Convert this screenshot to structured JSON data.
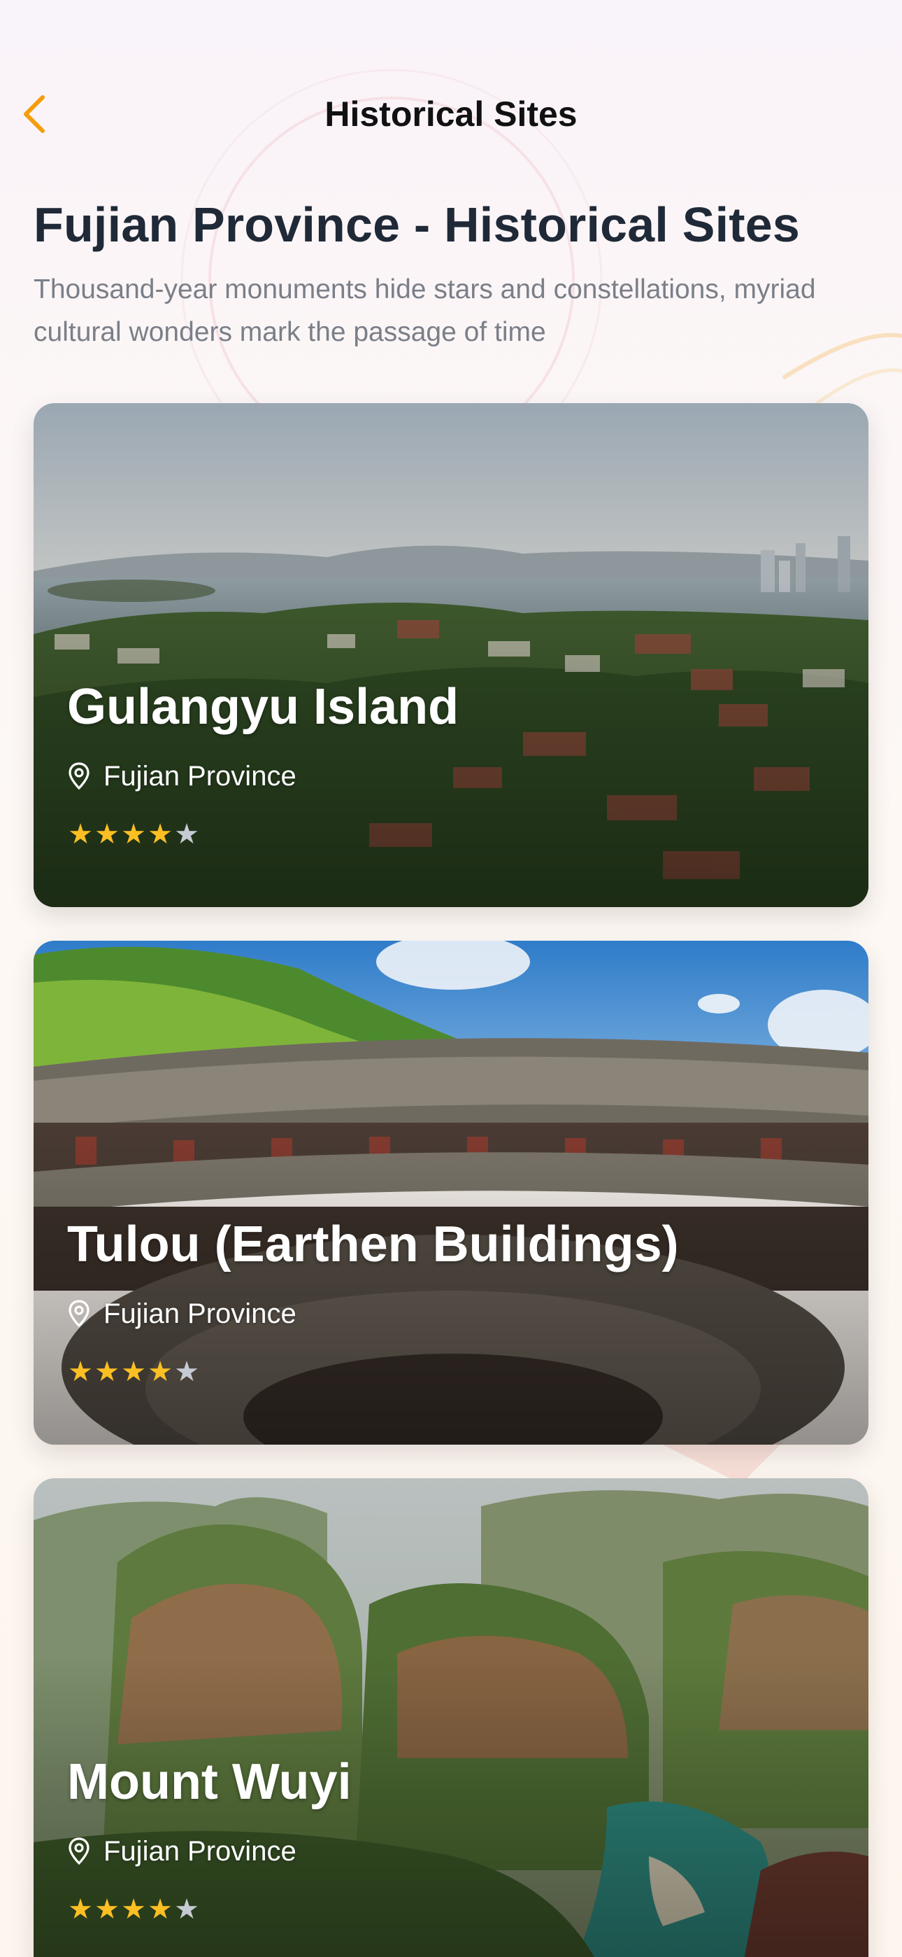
{
  "nav": {
    "back_icon": "chevron-left-icon",
    "title": "Historical Sites"
  },
  "colors": {
    "accent": "#f59e0b",
    "star_filled": "#fbbf24",
    "star_empty": "#c6cad2",
    "heading": "#1f2937",
    "subtitle": "#7a7f88"
  },
  "page": {
    "heading": "Fujian Province - Historical Sites",
    "subtitle": "Thousand-year monuments hide stars and constellations, myriad cultural wonders mark the passage of time"
  },
  "sites": [
    {
      "name": "Gulangyu Island",
      "location": "Fujian Province",
      "location_icon": "map-pin-icon",
      "rating": 4,
      "rating_max": 5
    },
    {
      "name": "Tulou (Earthen Buildings)",
      "location": "Fujian Province",
      "location_icon": "map-pin-icon",
      "rating": 4,
      "rating_max": 5
    },
    {
      "name": "Mount Wuyi",
      "location": "Fujian Province",
      "location_icon": "map-pin-icon",
      "rating": 4,
      "rating_max": 5
    }
  ]
}
